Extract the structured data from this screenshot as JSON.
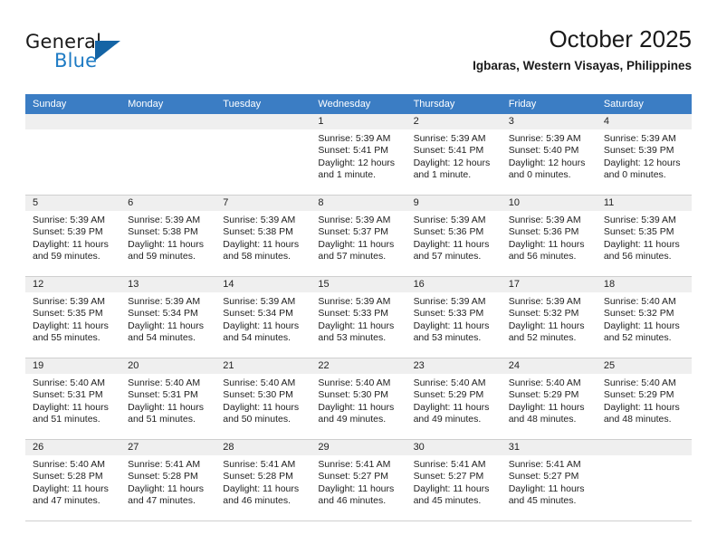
{
  "brand": {
    "name_part1": "General",
    "name_part2": "Blue",
    "logo_icon": "triangle-logo-icon",
    "accent_color": "#1464a5",
    "blue_text_color": "#1e7bc4"
  },
  "header": {
    "title": "October 2025",
    "subtitle": "Igbaras, Western Visayas, Philippines"
  },
  "calendar": {
    "header_bg": "#3b7dc4",
    "daynum_bg": "#efefef",
    "weekdays": [
      "Sunday",
      "Monday",
      "Tuesday",
      "Wednesday",
      "Thursday",
      "Friday",
      "Saturday"
    ],
    "weeks": [
      [
        {
          "day": "",
          "sunrise": "",
          "sunset": "",
          "daylight": "",
          "empty": true
        },
        {
          "day": "",
          "sunrise": "",
          "sunset": "",
          "daylight": "",
          "empty": true
        },
        {
          "day": "",
          "sunrise": "",
          "sunset": "",
          "daylight": "",
          "empty": true
        },
        {
          "day": "1",
          "sunrise": "Sunrise: 5:39 AM",
          "sunset": "Sunset: 5:41 PM",
          "daylight": "Daylight: 12 hours and 1 minute."
        },
        {
          "day": "2",
          "sunrise": "Sunrise: 5:39 AM",
          "sunset": "Sunset: 5:41 PM",
          "daylight": "Daylight: 12 hours and 1 minute."
        },
        {
          "day": "3",
          "sunrise": "Sunrise: 5:39 AM",
          "sunset": "Sunset: 5:40 PM",
          "daylight": "Daylight: 12 hours and 0 minutes."
        },
        {
          "day": "4",
          "sunrise": "Sunrise: 5:39 AM",
          "sunset": "Sunset: 5:39 PM",
          "daylight": "Daylight: 12 hours and 0 minutes."
        }
      ],
      [
        {
          "day": "5",
          "sunrise": "Sunrise: 5:39 AM",
          "sunset": "Sunset: 5:39 PM",
          "daylight": "Daylight: 11 hours and 59 minutes."
        },
        {
          "day": "6",
          "sunrise": "Sunrise: 5:39 AM",
          "sunset": "Sunset: 5:38 PM",
          "daylight": "Daylight: 11 hours and 59 minutes."
        },
        {
          "day": "7",
          "sunrise": "Sunrise: 5:39 AM",
          "sunset": "Sunset: 5:38 PM",
          "daylight": "Daylight: 11 hours and 58 minutes."
        },
        {
          "day": "8",
          "sunrise": "Sunrise: 5:39 AM",
          "sunset": "Sunset: 5:37 PM",
          "daylight": "Daylight: 11 hours and 57 minutes."
        },
        {
          "day": "9",
          "sunrise": "Sunrise: 5:39 AM",
          "sunset": "Sunset: 5:36 PM",
          "daylight": "Daylight: 11 hours and 57 minutes."
        },
        {
          "day": "10",
          "sunrise": "Sunrise: 5:39 AM",
          "sunset": "Sunset: 5:36 PM",
          "daylight": "Daylight: 11 hours and 56 minutes."
        },
        {
          "day": "11",
          "sunrise": "Sunrise: 5:39 AM",
          "sunset": "Sunset: 5:35 PM",
          "daylight": "Daylight: 11 hours and 56 minutes."
        }
      ],
      [
        {
          "day": "12",
          "sunrise": "Sunrise: 5:39 AM",
          "sunset": "Sunset: 5:35 PM",
          "daylight": "Daylight: 11 hours and 55 minutes."
        },
        {
          "day": "13",
          "sunrise": "Sunrise: 5:39 AM",
          "sunset": "Sunset: 5:34 PM",
          "daylight": "Daylight: 11 hours and 54 minutes."
        },
        {
          "day": "14",
          "sunrise": "Sunrise: 5:39 AM",
          "sunset": "Sunset: 5:34 PM",
          "daylight": "Daylight: 11 hours and 54 minutes."
        },
        {
          "day": "15",
          "sunrise": "Sunrise: 5:39 AM",
          "sunset": "Sunset: 5:33 PM",
          "daylight": "Daylight: 11 hours and 53 minutes."
        },
        {
          "day": "16",
          "sunrise": "Sunrise: 5:39 AM",
          "sunset": "Sunset: 5:33 PM",
          "daylight": "Daylight: 11 hours and 53 minutes."
        },
        {
          "day": "17",
          "sunrise": "Sunrise: 5:39 AM",
          "sunset": "Sunset: 5:32 PM",
          "daylight": "Daylight: 11 hours and 52 minutes."
        },
        {
          "day": "18",
          "sunrise": "Sunrise: 5:40 AM",
          "sunset": "Sunset: 5:32 PM",
          "daylight": "Daylight: 11 hours and 52 minutes."
        }
      ],
      [
        {
          "day": "19",
          "sunrise": "Sunrise: 5:40 AM",
          "sunset": "Sunset: 5:31 PM",
          "daylight": "Daylight: 11 hours and 51 minutes."
        },
        {
          "day": "20",
          "sunrise": "Sunrise: 5:40 AM",
          "sunset": "Sunset: 5:31 PM",
          "daylight": "Daylight: 11 hours and 51 minutes."
        },
        {
          "day": "21",
          "sunrise": "Sunrise: 5:40 AM",
          "sunset": "Sunset: 5:30 PM",
          "daylight": "Daylight: 11 hours and 50 minutes."
        },
        {
          "day": "22",
          "sunrise": "Sunrise: 5:40 AM",
          "sunset": "Sunset: 5:30 PM",
          "daylight": "Daylight: 11 hours and 49 minutes."
        },
        {
          "day": "23",
          "sunrise": "Sunrise: 5:40 AM",
          "sunset": "Sunset: 5:29 PM",
          "daylight": "Daylight: 11 hours and 49 minutes."
        },
        {
          "day": "24",
          "sunrise": "Sunrise: 5:40 AM",
          "sunset": "Sunset: 5:29 PM",
          "daylight": "Daylight: 11 hours and 48 minutes."
        },
        {
          "day": "25",
          "sunrise": "Sunrise: 5:40 AM",
          "sunset": "Sunset: 5:29 PM",
          "daylight": "Daylight: 11 hours and 48 minutes."
        }
      ],
      [
        {
          "day": "26",
          "sunrise": "Sunrise: 5:40 AM",
          "sunset": "Sunset: 5:28 PM",
          "daylight": "Daylight: 11 hours and 47 minutes."
        },
        {
          "day": "27",
          "sunrise": "Sunrise: 5:41 AM",
          "sunset": "Sunset: 5:28 PM",
          "daylight": "Daylight: 11 hours and 47 minutes."
        },
        {
          "day": "28",
          "sunrise": "Sunrise: 5:41 AM",
          "sunset": "Sunset: 5:28 PM",
          "daylight": "Daylight: 11 hours and 46 minutes."
        },
        {
          "day": "29",
          "sunrise": "Sunrise: 5:41 AM",
          "sunset": "Sunset: 5:27 PM",
          "daylight": "Daylight: 11 hours and 46 minutes."
        },
        {
          "day": "30",
          "sunrise": "Sunrise: 5:41 AM",
          "sunset": "Sunset: 5:27 PM",
          "daylight": "Daylight: 11 hours and 45 minutes."
        },
        {
          "day": "31",
          "sunrise": "Sunrise: 5:41 AM",
          "sunset": "Sunset: 5:27 PM",
          "daylight": "Daylight: 11 hours and 45 minutes."
        },
        {
          "day": "",
          "sunrise": "",
          "sunset": "",
          "daylight": "",
          "empty": true
        }
      ]
    ]
  }
}
